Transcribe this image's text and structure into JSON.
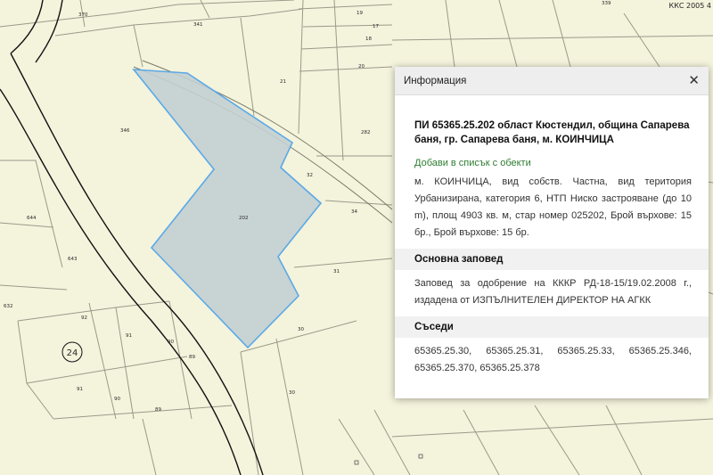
{
  "map": {
    "crs_label": "ККС 2005 4",
    "region_badge": "24",
    "selected_parcel_label": "202",
    "parcel_labels": [
      "370",
      "341",
      "19",
      "17",
      "18",
      "339",
      "20",
      "21",
      "346",
      "282",
      "32",
      "644",
      "34",
      "643",
      "31",
      "632",
      "92",
      "91",
      "90",
      "30",
      "89",
      "91",
      "90",
      "89",
      "30"
    ],
    "colors": {
      "background": "#f4f3dc",
      "selected_fill": "#c3cfd3",
      "selected_stroke": "#5aa9e6",
      "parcel_line": "#9a9a8a"
    }
  },
  "panel": {
    "title": "Информация",
    "close_icon": "close-icon",
    "parcel_heading": "ПИ 65365.25.202 област Кюстендил, община Сапарева баня, гр. Сапарева баня, м. КОИНЧИЦА",
    "add_link": "Добави в списък с обекти",
    "description": "м. КОИНЧИЦА, вид собств. Частна, вид територия Урбанизирана, категория 6, НТП Ниско застрояване (до 10 m), площ 4903 кв. м, стар номер 025202, Брой върхове: 15 бр., Брой върхове: 15 бр.",
    "order_heading": "Основна заповед",
    "order_text": "Заповед за одобрение на КККР РД-18-15/19.02.2008 г., издадена от ИЗПЪЛНИТЕЛЕН ДИРЕКТОР НА АГКК",
    "neighbors_heading": "Съседи",
    "neighbors_text": "65365.25.30, 65365.25.31, 65365.25.33, 65365.25.346, 65365.25.370, 65365.25.378"
  }
}
